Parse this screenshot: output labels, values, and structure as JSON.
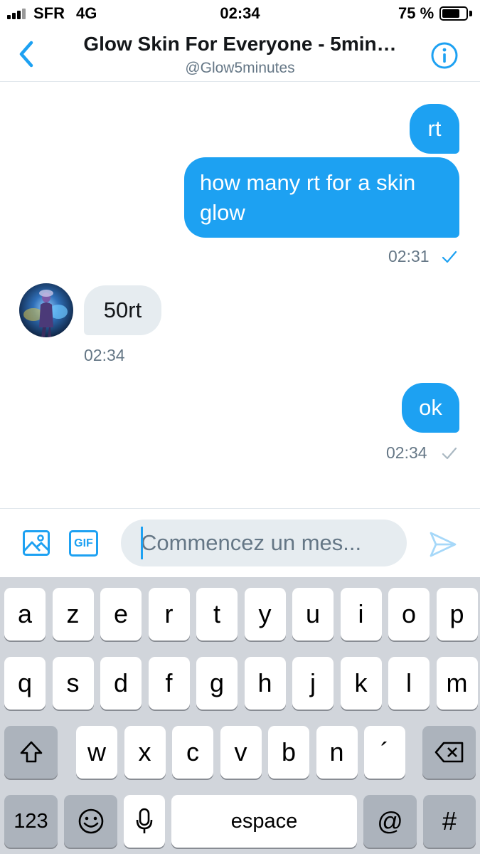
{
  "status_bar": {
    "carrier": "SFR",
    "network": "4G",
    "time": "02:34",
    "battery_percent": "75 %",
    "battery_level": 0.75
  },
  "header": {
    "title": "Glow Skin For Everyone - 5min…",
    "handle": "@Glow5minutes",
    "back_icon": "chevron-left-icon",
    "info_icon": "info-icon",
    "accent_color": "#1da1f2"
  },
  "messages": [
    {
      "direction": "sent",
      "text": "rt"
    },
    {
      "direction": "sent",
      "text_line1": "how many rt for a skin",
      "text_line2": "glow",
      "time": "02:31",
      "status_icon": "check-icon"
    },
    {
      "direction": "received",
      "text": "50rt",
      "time": "02:34",
      "avatar_icon": "avatar-image"
    },
    {
      "direction": "sent",
      "text": "ok",
      "time": "02:34",
      "status_icon": "check-icon"
    }
  ],
  "composer": {
    "placeholder": "Commencez un mes...",
    "value": "",
    "media_icon": "image-icon",
    "gif_label": "GIF",
    "send_icon": "send-icon"
  },
  "keyboard": {
    "row1": [
      "a",
      "z",
      "e",
      "r",
      "t",
      "y",
      "u",
      "i",
      "o",
      "p"
    ],
    "row2": [
      "q",
      "s",
      "d",
      "f",
      "g",
      "h",
      "j",
      "k",
      "l",
      "m"
    ],
    "row3": [
      "w",
      "x",
      "c",
      "v",
      "b",
      "n",
      "´"
    ],
    "numbers_label": "123",
    "space_label": "espace",
    "at_label": "@",
    "hash_label": "#",
    "shift_icon": "shift-icon",
    "delete_icon": "backspace-icon",
    "emoji_icon": "emoji-icon",
    "mic_icon": "microphone-icon"
  }
}
